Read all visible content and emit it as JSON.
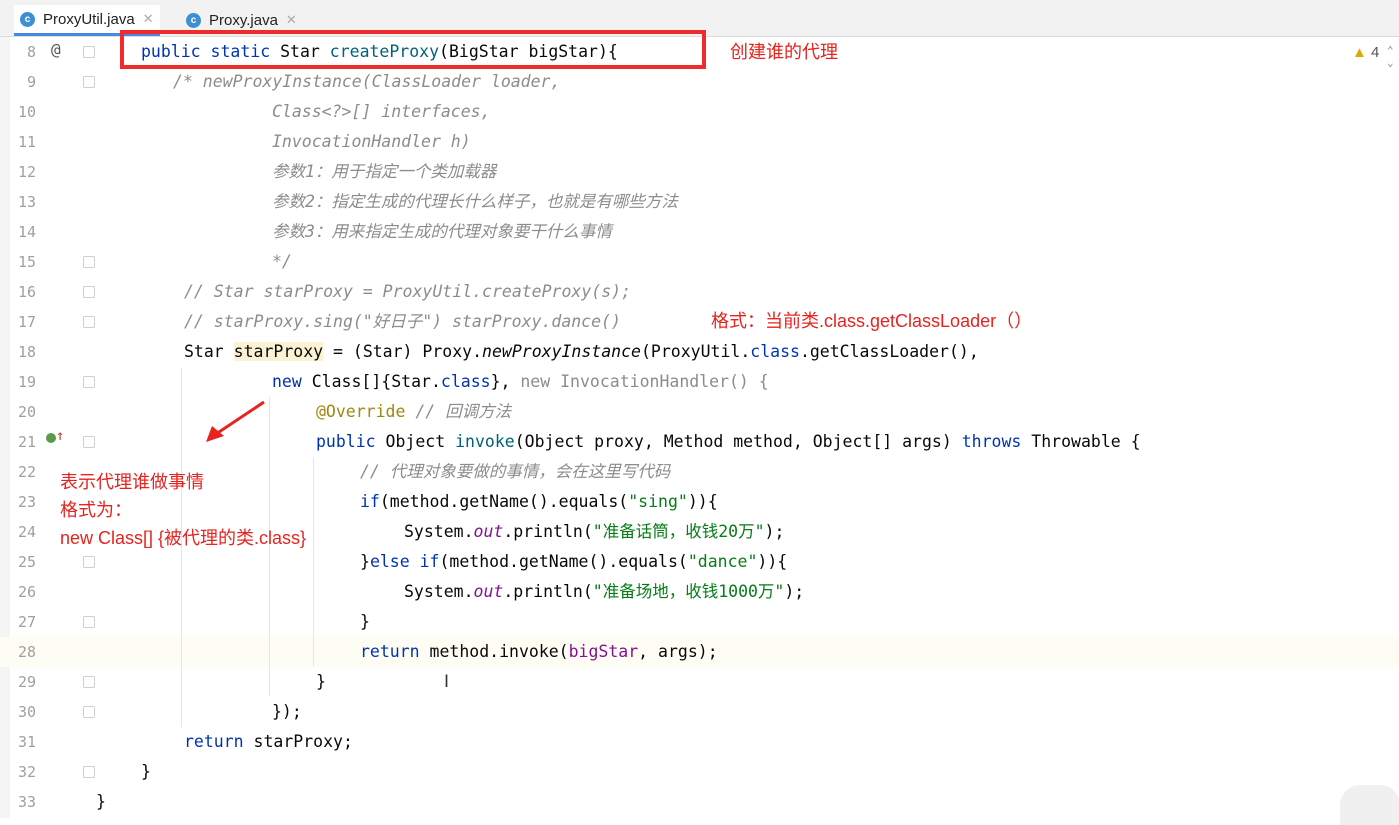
{
  "tabs": [
    {
      "label": "ProxyUtil.java",
      "icon": "java-class-icon",
      "active": true
    },
    {
      "label": "Proxy.java",
      "icon": "java-class-icon",
      "active": false
    }
  ],
  "inspection": {
    "count": "4"
  },
  "gutter": {
    "at_symbol": "@"
  },
  "lines": [
    {
      "num": "8"
    },
    {
      "num": "9"
    },
    {
      "num": "10"
    },
    {
      "num": "11"
    },
    {
      "num": "12"
    },
    {
      "num": "13"
    },
    {
      "num": "14"
    },
    {
      "num": "15"
    },
    {
      "num": "16"
    },
    {
      "num": "17"
    },
    {
      "num": "18"
    },
    {
      "num": "19"
    },
    {
      "num": "20"
    },
    {
      "num": "21"
    },
    {
      "num": "22"
    },
    {
      "num": "23"
    },
    {
      "num": "24"
    },
    {
      "num": "25"
    },
    {
      "num": "26"
    },
    {
      "num": "27"
    },
    {
      "num": "28"
    },
    {
      "num": "29"
    },
    {
      "num": "30"
    },
    {
      "num": "31"
    },
    {
      "num": "32"
    },
    {
      "num": "33"
    }
  ],
  "code": {
    "l8": {
      "public": "public ",
      "static": "static ",
      "type": "Star ",
      "method": "createProxy",
      "params": "(BigStar bigStar){"
    },
    "l9": "/* newProxyInstance(ClassLoader loader,",
    "l10": "Class<?>[] interfaces,",
    "l11": "InvocationHandler h)",
    "l12": "参数1：用于指定一个类加载器",
    "l13": "参数2：指定生成的代理长什么样子，也就是有哪些方法",
    "l14": "参数3：用来指定生成的代理对象要干什么事情",
    "l15": "*/",
    "l16": "// Star starProxy = ProxyUtil.createProxy(s);",
    "l17": "// starProxy.sing(\"好日子\") starProxy.dance()",
    "l18": {
      "a": "Star ",
      "var": "starProxy",
      "b": " = (Star) Proxy.",
      "call": "newProxyInstance",
      "c": "(ProxyUtil.",
      "kw": "class",
      "d": ".getClassLoader(),"
    },
    "l19": {
      "new1": "new ",
      "a": "Class[]{Star.",
      "kw": "class",
      "b": "}, ",
      "new2": "new ",
      "c": "InvocationHandler() {"
    },
    "l20": {
      "ann": "@Override",
      "cm": " // 回调方法"
    },
    "l21": {
      "public": "public ",
      "a": "Object ",
      "method": "invoke",
      "b": "(Object proxy, Method method, Object[] args) ",
      "throws": "throws",
      "c": " Throwable {"
    },
    "l22": "// 代理对象要做的事情，会在这里写代码",
    "l23": {
      "if": "if",
      "a": "(method.getName().equals(",
      "str": "\"sing\"",
      "b": ")){"
    },
    "l24": {
      "a": "System.",
      "out": "out",
      "b": ".println(",
      "str": "\"准备话筒，收钱20万\"",
      "c": ");"
    },
    "l25": {
      "a": "}",
      "else": "else ",
      "if": "if",
      "b": "(method.getName().equals(",
      "str": "\"dance\"",
      "c": ")){"
    },
    "l26": {
      "a": "System.",
      "out": "out",
      "b": ".println(",
      "str": "\"准备场地，收钱1000万\"",
      "c": ");"
    },
    "l27": "}",
    "l28": {
      "return": "return ",
      "a": "method.invoke(",
      "var": "bigStar",
      "b": ", args);"
    },
    "l29": "}",
    "l30": "});",
    "l31": {
      "return": "return ",
      "a": "starProxy;"
    },
    "l32": "}",
    "l33": "}"
  },
  "notes": {
    "create": "创建谁的代理",
    "format": "格式：当前类.class.getClassLoader（）",
    "who1": "表示代理谁做事情",
    "who2": "格式为：",
    "who3": "new Class[] {被代理的类.class}"
  },
  "colors": {
    "annotation_red": "#e8231f",
    "keyword": "#0033b3",
    "string": "#067d17",
    "comment": "#8c8c8c"
  }
}
